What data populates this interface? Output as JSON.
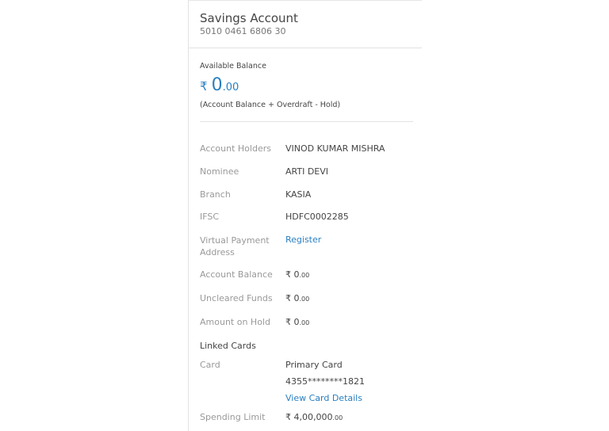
{
  "header": {
    "title": "Savings Account",
    "account_number": "5010 0461 6806 30"
  },
  "balance": {
    "label": "Available Balance",
    "currency": "₹",
    "whole": "0",
    "decimal": ".00",
    "formula": "(Account Balance + Overdraft - Hold)"
  },
  "details": [
    {
      "label": "Account Holders",
      "value": "VINOD KUMAR MISHRA"
    },
    {
      "label": "Nominee",
      "value": "ARTI DEVI"
    },
    {
      "label": "Branch",
      "value": "KASIA"
    },
    {
      "label": "IFSC",
      "value": "HDFC0002285"
    },
    {
      "label": "Virtual Payment Address",
      "value": "Register"
    },
    {
      "label": "Account Balance",
      "value": "₹ 0",
      "dec": ".00"
    },
    {
      "label": "Uncleared Funds",
      "value": "₹ 0",
      "dec": ".00"
    },
    {
      "label": "Amount on Hold",
      "value": "₹ 0",
      "dec": ".00"
    }
  ],
  "linked_cards": {
    "heading": "Linked Cards",
    "card_label": "Card",
    "card_name": "Primary Card",
    "card_number": "4355********1821",
    "view_link": "View Card Details",
    "limit_label": "Spending Limit",
    "limit_value": "₹ 4,00,000",
    "limit_dec": ".00"
  }
}
